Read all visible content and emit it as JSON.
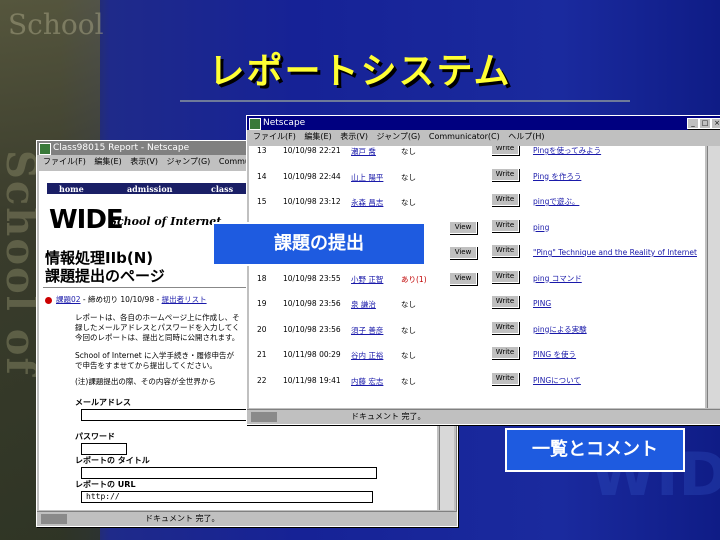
{
  "slide": {
    "title": "レポートシステム",
    "bg_logo": "School",
    "bg_vertical": "School of Internet",
    "bg_wide": "WIDE"
  },
  "back_window": {
    "title": "Class98015 Report - Netscape",
    "menu": [
      "ファイル(F)",
      "編集(E)",
      "表示(V)",
      "ジャンプ(G)",
      "Communicat"
    ],
    "nav": [
      "home",
      "admission",
      "class"
    ],
    "logo": "WIDE",
    "school": "School of Internet",
    "heading1": "情報処理IIb(N)",
    "heading2": "課題提出のページ",
    "assignment_link": "課題02",
    "deadline": " - 締め切り 10/10/98 - ",
    "list_link": "提出者リスト",
    "paragraph1": [
      "レポートは、各自のホームページ上に作成し、そ",
      "録したメールアドレスとパスワードを入力してく",
      "今回のレポートは、提出と同時に公開されます。"
    ],
    "paragraph2": [
      "School of Internet に入学手続き・履修申告が",
      "で申告をすませてから提出してください。"
    ],
    "paragraph3": "(注)課題提出の際、その内容が全世界から",
    "field_email": "メールアドレス",
    "field_password": "パスワード",
    "field_title": "レポートの タイトル",
    "field_url": "レポートの URL",
    "url_value": "http://",
    "status": "ドキュメント 完了。"
  },
  "front_window": {
    "title": "Netscape",
    "menu": [
      "ファイル(F)",
      "編集(E)",
      "表示(V)",
      "ジャンプ(G)",
      "Communicator(C)",
      "ヘルプ(H)"
    ],
    "view_label": "View",
    "write_label": "Write",
    "rows": [
      {
        "no": "13",
        "date": "10/10/98 22:21",
        "name": "瀬戸 喬",
        "file": "なし",
        "view": false,
        "title": "Pingを使ってみよう"
      },
      {
        "no": "14",
        "date": "10/10/98 22:44",
        "name": "山上 陽平",
        "file": "なし",
        "view": false,
        "title": "Ping を作ろう"
      },
      {
        "no": "15",
        "date": "10/10/98 23:12",
        "name": "永森 昌志",
        "file": "なし",
        "view": false,
        "title": "pingで遊ぶ。"
      },
      {
        "no": "",
        "date": "",
        "name": "",
        "file": "",
        "view": true,
        "title": "ping"
      },
      {
        "no": "",
        "date": "",
        "name": "",
        "file": "",
        "view": true,
        "title": "\"Ping\" Technique and the Reality of Internet"
      },
      {
        "no": "18",
        "date": "10/10/98 23:55",
        "name": "小野 正智",
        "file": "あり(1)",
        "view": true,
        "title": "ping コマンド"
      },
      {
        "no": "19",
        "date": "10/10/98 23:56",
        "name": "泉 謙治",
        "file": "なし",
        "view": false,
        "title": "PING"
      },
      {
        "no": "20",
        "date": "10/10/98 23:56",
        "name": "須子 善彦",
        "file": "なし",
        "view": false,
        "title": "pingによる実験"
      },
      {
        "no": "21",
        "date": "10/11/98 00:29",
        "name": "谷内 正裕",
        "file": "なし",
        "view": false,
        "title": "PING を使う"
      },
      {
        "no": "22",
        "date": "10/11/98 19:41",
        "name": "内藤 宏志",
        "file": "なし",
        "view": false,
        "title": "PINGについて"
      }
    ],
    "status": "ドキュメント 完了。"
  },
  "callouts": {
    "submit": "課題の提出",
    "list": "一覧とコメント"
  },
  "colors": {
    "title": "#ffff33",
    "callout": "#1e5be0",
    "link": "#1a1aaa",
    "active_title": "#000080"
  }
}
